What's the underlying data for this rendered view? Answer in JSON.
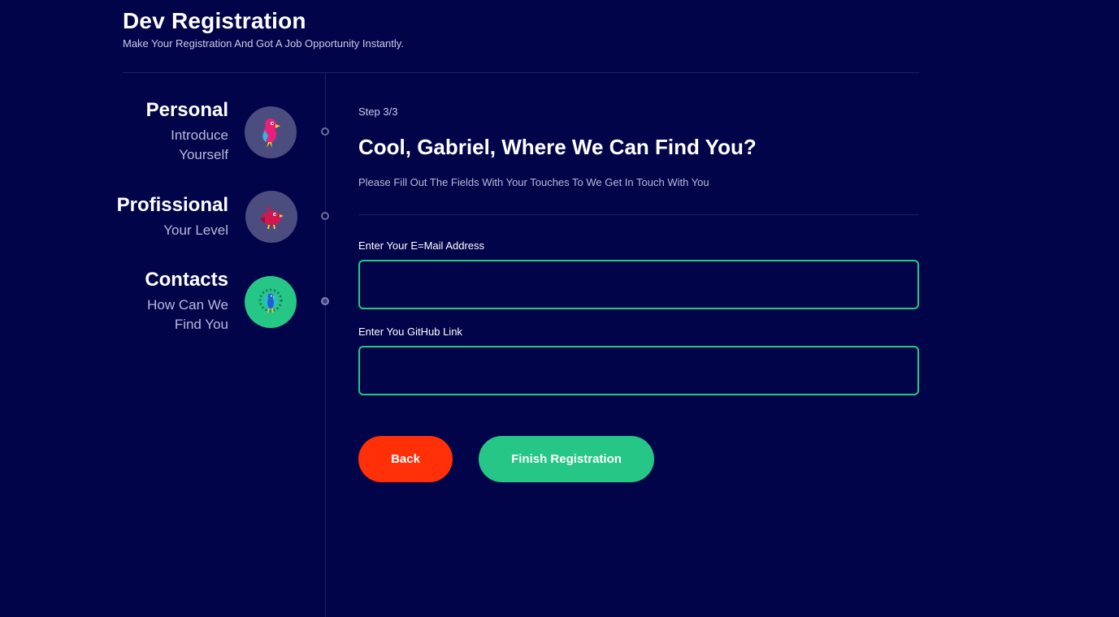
{
  "header": {
    "title": "Dev Registration",
    "subtitle": "Make Your Registration And Got A Job Opportunity Instantly."
  },
  "steps": [
    {
      "title": "Personal",
      "desc_line1": "Introduce",
      "desc_line2": "Yourself",
      "icon": "parrot-icon",
      "active": false
    },
    {
      "title": "Profissional",
      "desc_line1": "Your Level",
      "icon": "bird-icon",
      "active": false
    },
    {
      "title": "Contacts",
      "desc_line1": "How Can We",
      "desc_line2": "Find You",
      "icon": "peacock-icon",
      "active": true
    }
  ],
  "main": {
    "step_count": "Step 3/3",
    "question": "Cool, Gabriel, Where We Can Find You?",
    "hint": "Please Fill Out The Fields With Your Touches To We Get In Touch With You",
    "email_label": "Enter Your E=Mail Address",
    "email_value": "",
    "github_label": "Enter You GitHub Link",
    "github_value": ""
  },
  "buttons": {
    "back": "Back",
    "finish": "Finish Registration"
  },
  "colors": {
    "background": "#02044a",
    "accent": "#25c686",
    "back_button": "#ff3007",
    "inactive_avatar": "#4a4d7e"
  }
}
